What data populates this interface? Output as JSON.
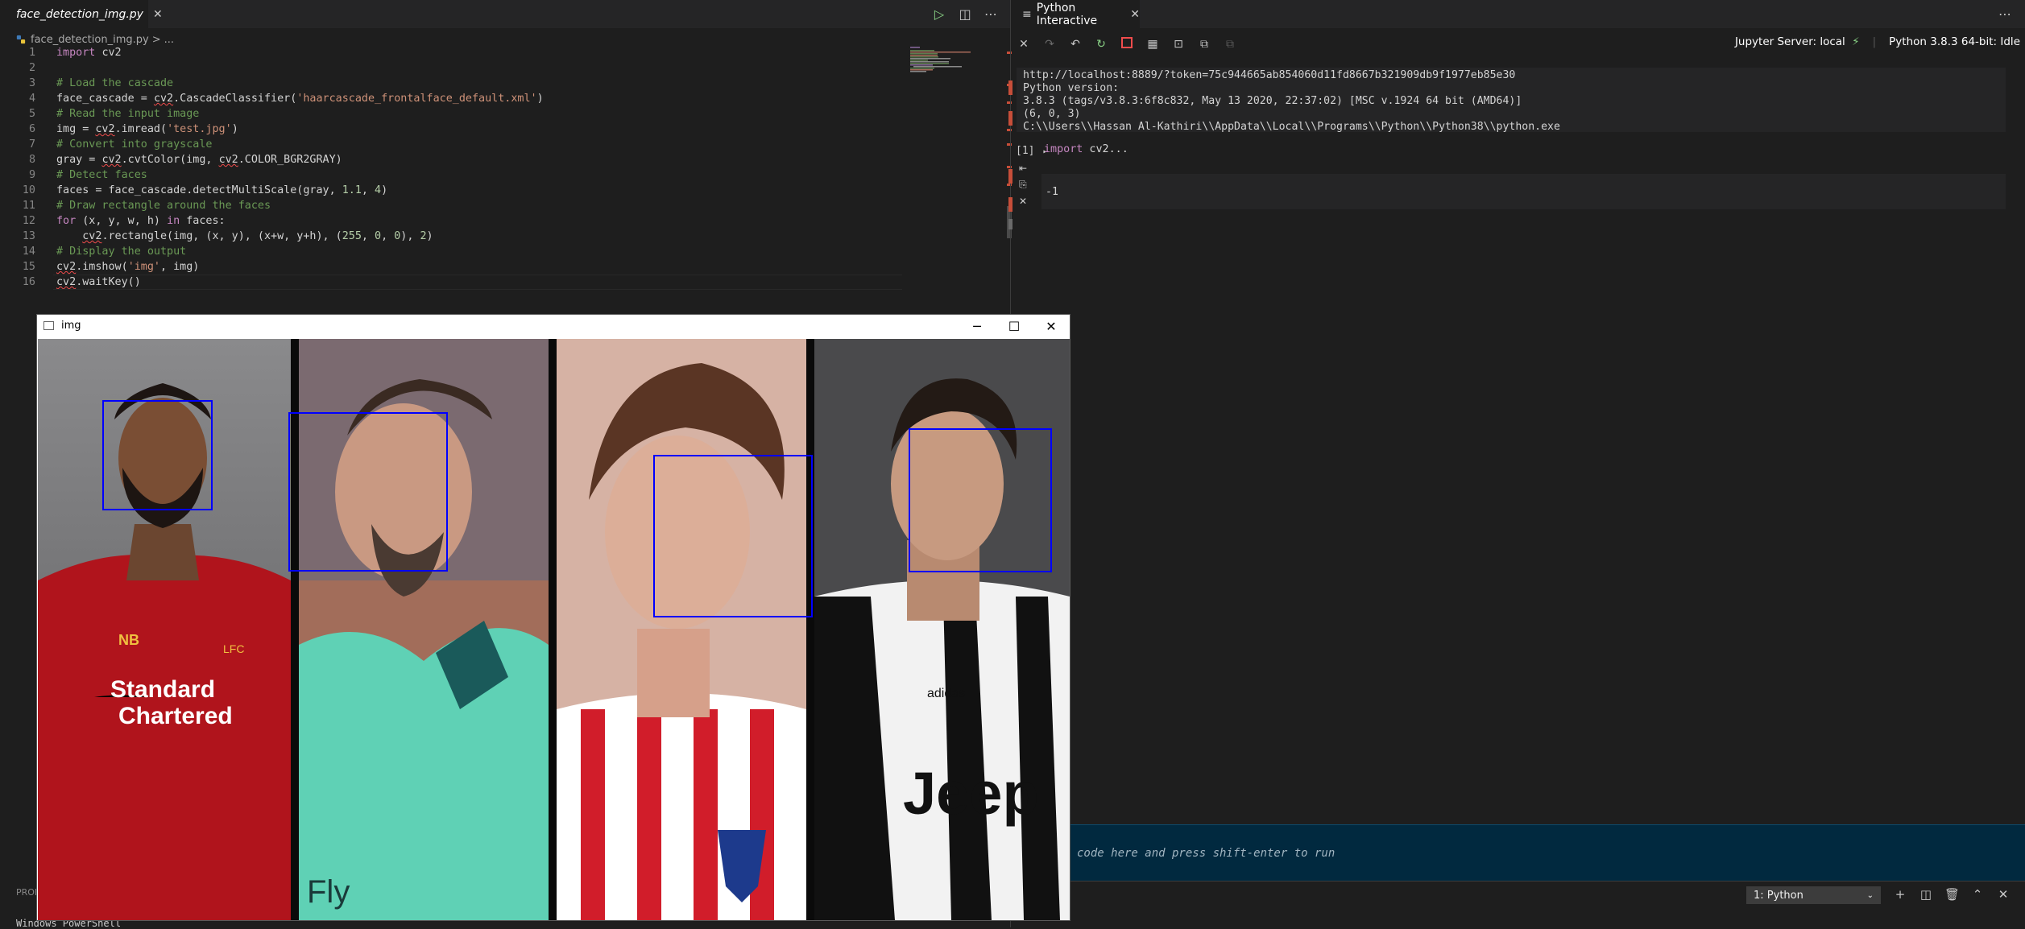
{
  "editor": {
    "tab_label": "face_detection_img.py",
    "breadcrumb": {
      "file": "face_detection_img.py",
      "sep": ">",
      "more": "..."
    },
    "lines": [
      {
        "n": "1",
        "tokens": [
          {
            "t": "import ",
            "c": "k"
          },
          {
            "t": "cv2",
            "c": "t"
          }
        ]
      },
      {
        "n": "2",
        "tokens": []
      },
      {
        "n": "3",
        "tokens": [
          {
            "t": "# Load the cascade",
            "c": "c"
          }
        ]
      },
      {
        "n": "4",
        "tokens": [
          {
            "t": "face_cascade = ",
            "c": "t"
          },
          {
            "t": "cv2",
            "c": "t",
            "sq": true
          },
          {
            "t": ".CascadeClassifier(",
            "c": "t"
          },
          {
            "t": "'haarcascade_frontalface_default.xml'",
            "c": "s"
          },
          {
            "t": ")",
            "c": "t"
          }
        ]
      },
      {
        "n": "5",
        "tokens": [
          {
            "t": "# Read the input image",
            "c": "c"
          }
        ]
      },
      {
        "n": "6",
        "tokens": [
          {
            "t": "img = ",
            "c": "t"
          },
          {
            "t": "cv2",
            "c": "t",
            "sq": true
          },
          {
            "t": ".imread(",
            "c": "t"
          },
          {
            "t": "'test.jpg'",
            "c": "s"
          },
          {
            "t": ")",
            "c": "t"
          }
        ]
      },
      {
        "n": "7",
        "tokens": [
          {
            "t": "# Convert into grayscale",
            "c": "c"
          }
        ]
      },
      {
        "n": "8",
        "tokens": [
          {
            "t": "gray = ",
            "c": "t"
          },
          {
            "t": "cv2",
            "c": "t",
            "sq": true
          },
          {
            "t": ".cvtColor(img, ",
            "c": "t"
          },
          {
            "t": "cv2",
            "c": "t",
            "sq": true
          },
          {
            "t": ".COLOR_BGR2GRAY)",
            "c": "t"
          }
        ]
      },
      {
        "n": "9",
        "tokens": [
          {
            "t": "# Detect faces",
            "c": "c"
          }
        ]
      },
      {
        "n": "10",
        "tokens": [
          {
            "t": "faces = face_cascade.detectMultiScale(gray, ",
            "c": "t"
          },
          {
            "t": "1.1",
            "c": "n"
          },
          {
            "t": ", ",
            "c": "t"
          },
          {
            "t": "4",
            "c": "n"
          },
          {
            "t": ")",
            "c": "t"
          }
        ]
      },
      {
        "n": "11",
        "tokens": [
          {
            "t": "# Draw rectangle around the faces",
            "c": "c"
          }
        ]
      },
      {
        "n": "12",
        "tokens": [
          {
            "t": "for",
            "c": "k"
          },
          {
            "t": " (x, y, w, h) ",
            "c": "t"
          },
          {
            "t": "in",
            "c": "k"
          },
          {
            "t": " faces:",
            "c": "t"
          }
        ]
      },
      {
        "n": "13",
        "tokens": [
          {
            "t": "    ",
            "c": "t"
          },
          {
            "t": "cv2",
            "c": "t",
            "sq": true
          },
          {
            "t": ".rectangle(img, (x, y), (x+w, y+h), (",
            "c": "t"
          },
          {
            "t": "255",
            "c": "n"
          },
          {
            "t": ", ",
            "c": "t"
          },
          {
            "t": "0",
            "c": "n"
          },
          {
            "t": ", ",
            "c": "t"
          },
          {
            "t": "0",
            "c": "n"
          },
          {
            "t": "), ",
            "c": "t"
          },
          {
            "t": "2",
            "c": "n"
          },
          {
            "t": ")",
            "c": "t"
          }
        ]
      },
      {
        "n": "14",
        "tokens": [
          {
            "t": "# Display the output",
            "c": "c"
          }
        ]
      },
      {
        "n": "15",
        "tokens": [
          {
            "t": "cv2",
            "c": "t",
            "sq": true
          },
          {
            "t": ".imshow(",
            "c": "t"
          },
          {
            "t": "'img'",
            "c": "s"
          },
          {
            "t": ", img)",
            "c": "t"
          }
        ]
      },
      {
        "n": "16",
        "tokens": [
          {
            "t": "cv2",
            "c": "t",
            "sq": true
          },
          {
            "t": ".waitKey()",
            "c": "t"
          }
        ]
      }
    ]
  },
  "interactive": {
    "tab_label": "Python Interactive",
    "jupyter_status": "Jupyter Server: local",
    "kernel_status": "Python 3.8.3 64-bit: Idle",
    "output_lines": [
      "http://localhost:8889/?token=75c944665ab854060d11fd8667b321909db9f1977eb85e30",
      "Python version:",
      "3.8.3 (tags/v3.8.3:6f8c832, May 13 2020, 22:37:02) [MSC v.1924 64 bit (AMD64)]",
      "(6, 0, 3)",
      "C:\\\\Users\\\\Hassan Al-Kathiri\\\\AppData\\\\Local\\\\Programs\\\\Python\\\\Python38\\\\python.exe"
    ],
    "cell_label": "[1]",
    "cell_code_kw": "import",
    "cell_code_rest": " cv2...",
    "cell_output": "-1",
    "input_placeholder": "code here and press shift-enter to run"
  },
  "panel": {
    "problems_label": "PROB",
    "terminal_text": "Windows PowerShell",
    "terminal_select": "1: Python"
  },
  "image_window": {
    "title": "img"
  },
  "colors": {
    "face_box": "#0000ff",
    "accent_input_bg": "#01293f"
  }
}
